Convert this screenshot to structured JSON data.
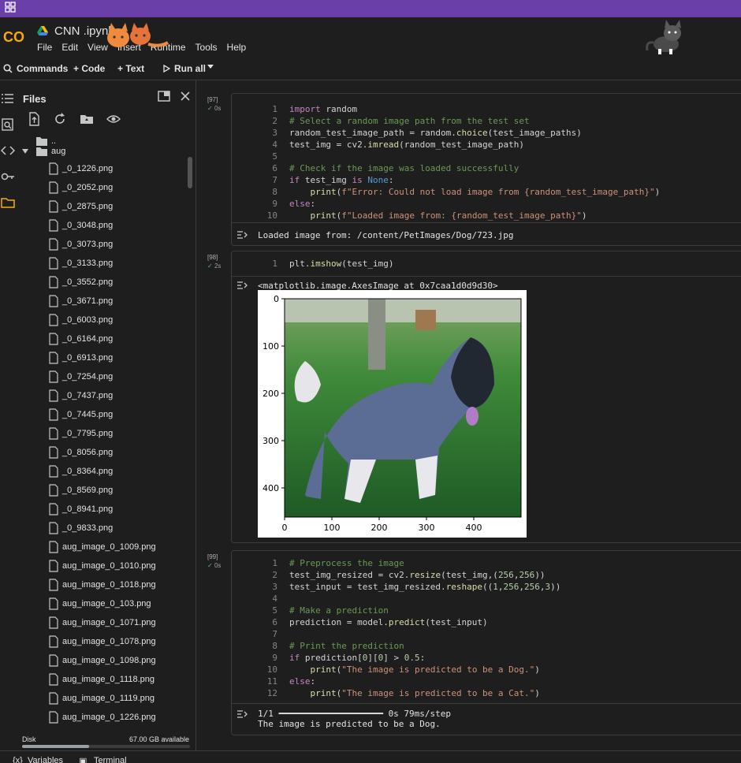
{
  "notebook": {
    "title": "CNN .ipynb"
  },
  "menu": [
    "File",
    "Edit",
    "View",
    "Insert",
    "Runtime",
    "Tools",
    "Help"
  ],
  "toolbar": {
    "commands": "Commands",
    "code": "+ Code",
    "text": "+ Text",
    "run_all": "Run all"
  },
  "files_panel": {
    "title": "Files",
    "parent_dir": "..",
    "folder": "aug",
    "files": [
      "_0_1226.png",
      "_0_2052.png",
      "_0_2875.png",
      "_0_3048.png",
      "_0_3073.png",
      "_0_3133.png",
      "_0_3552.png",
      "_0_3671.png",
      "_0_6003.png",
      "_0_6164.png",
      "_0_6913.png",
      "_0_7254.png",
      "_0_7437.png",
      "_0_7445.png",
      "_0_7795.png",
      "_0_8056.png",
      "_0_8364.png",
      "_0_8569.png",
      "_0_8941.png",
      "_0_9833.png",
      "aug_image_0_1009.png",
      "aug_image_0_1010.png",
      "aug_image_0_1018.png",
      "aug_image_0_103.png",
      "aug_image_0_1071.png",
      "aug_image_0_1078.png",
      "aug_image_0_1098.png",
      "aug_image_0_1118.png",
      "aug_image_0_1119.png",
      "aug_image_0_1226.png"
    ],
    "disk_label": "Disk",
    "disk_available": "67.00 GB available",
    "disk_used_fraction": 0.4
  },
  "status_bar": {
    "variables": "Variables",
    "terminal": "Terminal"
  },
  "cells": [
    {
      "exec_count": "[97]",
      "time": "0s",
      "lines": [
        "import random",
        "# Select a random image path from the test set",
        "random_test_image_path = random.choice(test_image_paths)",
        "test_img = cv2.imread(random_test_image_path)",
        "",
        "# Check if the image was loaded successfully",
        "if test_img is None:",
        "    print(f\"Error: Could not load image from {random_test_image_path}\")",
        "else:",
        "    print(f\"Loaded image from: {random_test_image_path}\")"
      ],
      "output": [
        "Loaded image from: /content/PetImages/Dog/723.jpg"
      ]
    },
    {
      "exec_count": "[98]",
      "time": "2s",
      "lines": [
        "plt.imshow(test_img)"
      ],
      "output": [
        "<matplotlib.image.AxesImage at 0x7caa1d0d9d30>"
      ]
    },
    {
      "exec_count": "[99]",
      "time": "0s",
      "lines": [
        "# Preprocess the image",
        "test_img_resized = cv2.resize(test_img,(256,256))",
        "test_input = test_img_resized.reshape((1,256,256,3))",
        "",
        "# Make a prediction",
        "prediction = model.predict(test_input)",
        "",
        "# Print the prediction",
        "if prediction[0][0] > 0.5:",
        "    print(\"The image is predicted to be a Dog.\")",
        "else:",
        "    print(\"The image is predicted to be a Cat.\")"
      ],
      "output": [
        "1/1 ━━━━━━━━━━━━━━━━━━━━ 0s 79ms/step",
        "The image is predicted to be a Dog."
      ]
    }
  ],
  "plot": {
    "x_ticks": [
      "0",
      "100",
      "200",
      "300",
      "400"
    ],
    "y_ticks": [
      "0",
      "100",
      "200",
      "300",
      "400"
    ]
  }
}
